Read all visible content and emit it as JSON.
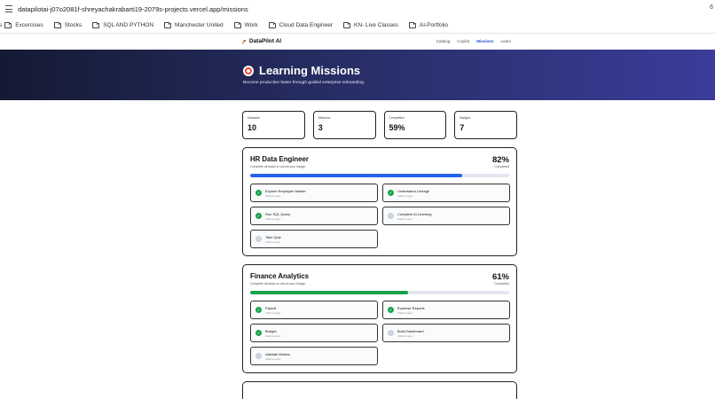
{
  "browser": {
    "url": "datapilotai-j07o2081f-shreyachakrabarti19-2079s-projects.vercel.app/missions",
    "edge_char": "6",
    "bookmarks": [
      "Excercises",
      "Stocks",
      "SQL AND PYTHON",
      "Manchester United",
      "Work",
      "Cloud Data Engineer",
      "KN- Live Classes",
      "AI-Portfolio"
    ]
  },
  "nav": {
    "brand": "DataPilot AI",
    "links": [
      "Catalog",
      "Copilot",
      "Missions",
      "Learn"
    ],
    "active": "Missions"
  },
  "hero": {
    "title": "Learning Missions",
    "subtitle": "Become productive faster through guided enterprise onboarding."
  },
  "stats": [
    {
      "label": "Datasets",
      "value": "10"
    },
    {
      "label": "Missions",
      "value": "3"
    },
    {
      "label": "Completion",
      "value": "59%"
    },
    {
      "label": "Badges",
      "value": "7"
    }
  ],
  "missions": [
    {
      "title": "HR Data Engineer",
      "subtitle": "Complete all tasks to unlock your badge.",
      "percent": "82%",
      "percent_label": "Completed",
      "progress": 0.82,
      "bar_color": "#2563eb",
      "tasks": [
        {
          "name": "Explore Employee Master",
          "hint": "Click to open",
          "done": true
        },
        {
          "name": "Understand Lineage",
          "hint": "Click to open",
          "done": true
        },
        {
          "name": "Run SQL Query",
          "hint": "Click to open",
          "done": true
        },
        {
          "name": "Complete AI Learning",
          "hint": "Click to open",
          "done": false
        },
        {
          "name": "Take Quiz",
          "hint": "Click to open",
          "done": false
        }
      ]
    },
    {
      "title": "Finance Analytics",
      "subtitle": "Complete all tasks to unlock your badge.",
      "percent": "61%",
      "percent_label": "Completed",
      "progress": 0.61,
      "bar_color": "#16a34a",
      "tasks": [
        {
          "name": "Payroll",
          "hint": "Click to open",
          "done": true
        },
        {
          "name": "Expense Reports",
          "hint": "Click to open",
          "done": true
        },
        {
          "name": "Budget",
          "hint": "Click to open",
          "done": true
        },
        {
          "name": "Build Dashboard",
          "hint": "Click to open",
          "done": false
        },
        {
          "name": "Validate Metrics",
          "hint": "Click to open",
          "done": false
        }
      ]
    }
  ],
  "icons": {
    "done": "check-icon",
    "todo": "pending-icon",
    "brand": "rocket-icon",
    "hero": "target-icon"
  }
}
